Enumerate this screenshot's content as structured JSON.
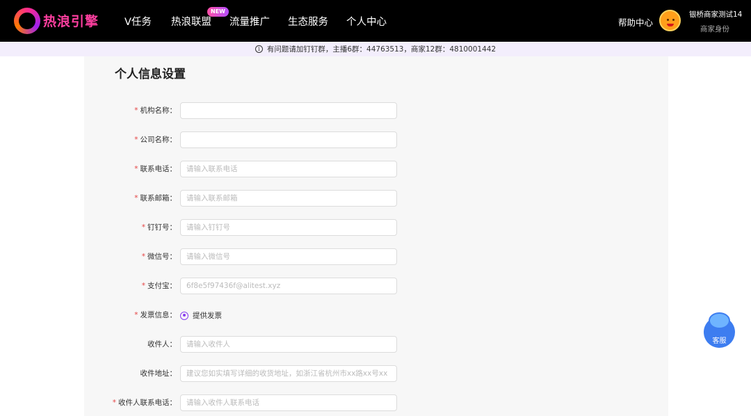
{
  "brand": {
    "name": "热浪引擎"
  },
  "nav": {
    "items": [
      {
        "label": "V任务"
      },
      {
        "label": "热浪联盟",
        "badge": "NEW"
      },
      {
        "label": "流量推广"
      },
      {
        "label": "生态服务"
      },
      {
        "label": "个人中心"
      }
    ],
    "help": "帮助中心",
    "user": {
      "name": "银桥商家测试14",
      "role": "商家身份"
    }
  },
  "notice": {
    "text": "有问题请加钉钉群，主播6群：44763513，商家12群：4810001442"
  },
  "page": {
    "title": "个人信息设置"
  },
  "form": {
    "fields": [
      {
        "label": "机构名称：",
        "required": true,
        "placeholder": "",
        "value": ""
      },
      {
        "label": "公司名称：",
        "required": true,
        "placeholder": "",
        "value": ""
      },
      {
        "label": "联系电话：",
        "required": true,
        "placeholder": "请输入联系电话",
        "value": ""
      },
      {
        "label": "联系邮箱：",
        "required": true,
        "placeholder": "请输入联系邮箱",
        "value": ""
      },
      {
        "label": "钉钉号：",
        "required": true,
        "placeholder": "请输入钉钉号",
        "value": ""
      },
      {
        "label": "微信号：",
        "required": true,
        "placeholder": "请输入微信号",
        "value": ""
      },
      {
        "label": "支付宝：",
        "required": true,
        "placeholder": "",
        "value": "6f8e5f97436f@alitest.xyz"
      },
      {
        "label": "发票信息：",
        "required": true,
        "radio": "提供发票"
      },
      {
        "label": "收件人：",
        "required": false,
        "placeholder": "请输入收件人",
        "value": ""
      },
      {
        "label": "收件地址：",
        "required": false,
        "placeholder": "建议您如实填写详细的收货地址，如浙江省杭州市xx路xx号xx",
        "value": ""
      },
      {
        "label": "收件人联系电话：",
        "required": true,
        "placeholder": "请输入收件人联系电话",
        "value": ""
      }
    ]
  },
  "service_button": {
    "label": "客服"
  },
  "colors": {
    "accent": "#8a3df0",
    "required": "#e54545",
    "topbar": "#000000",
    "notice_bg": "#f3eefc",
    "service": "#3d7df0"
  }
}
